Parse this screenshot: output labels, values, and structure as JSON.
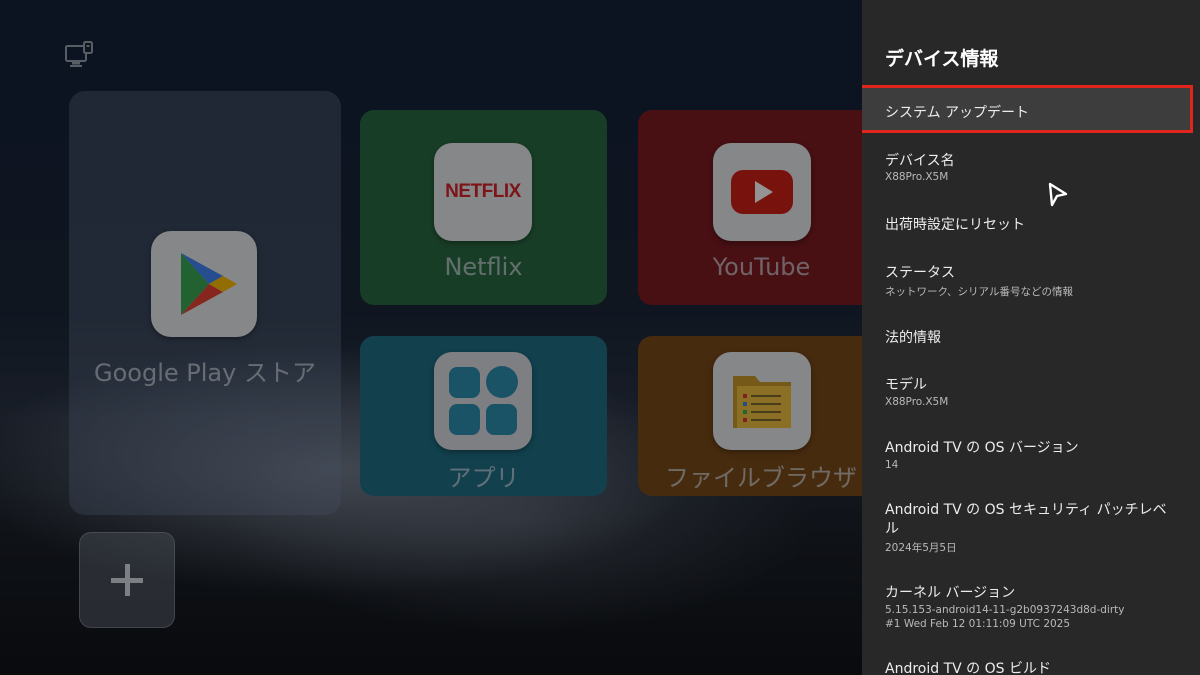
{
  "launcher": {
    "tiles": {
      "play": {
        "label": "Google Play ストア"
      },
      "netflix": {
        "label": "Netflix",
        "logo_text": "NETFLIX"
      },
      "youtube": {
        "label": "YouTube"
      },
      "apps": {
        "label": "アプリ"
      },
      "files": {
        "label": "ファイルブラウザ"
      }
    },
    "icons": {
      "input_source": "monitor-input-icon",
      "add": "plus-icon"
    }
  },
  "settings_panel": {
    "title": "デバイス情報",
    "items": [
      {
        "label": "システム アップデート",
        "selected": true
      },
      {
        "label": "デバイス名",
        "value": "X88Pro.X5M"
      },
      {
        "label": "出荷時設定にリセット"
      },
      {
        "label": "ステータス",
        "value": "ネットワーク、シリアル番号などの情報"
      },
      {
        "label": "法的情報"
      },
      {
        "label": "モデル",
        "value": "X88Pro.X5M"
      },
      {
        "label": "Android TV の OS バージョン",
        "value": "14"
      },
      {
        "label_line1": "Android TV の OS セキュリティ パッチレベ",
        "label_line2": "ル",
        "value": "2024年5月5日"
      },
      {
        "label": "カーネル バージョン",
        "value_line1": "5.15.153-android14-11-g2b0937243d8d-dirty",
        "value_line2": "#1 Wed Feb 12 01:11:09 UTC 2025"
      },
      {
        "label": "Android TV の OS ビルド"
      }
    ]
  },
  "colors": {
    "panel_bg": "#282828",
    "selection_border": "#e0261c",
    "netflix_red": "#d6242b",
    "youtube_red": "#e0231b"
  }
}
